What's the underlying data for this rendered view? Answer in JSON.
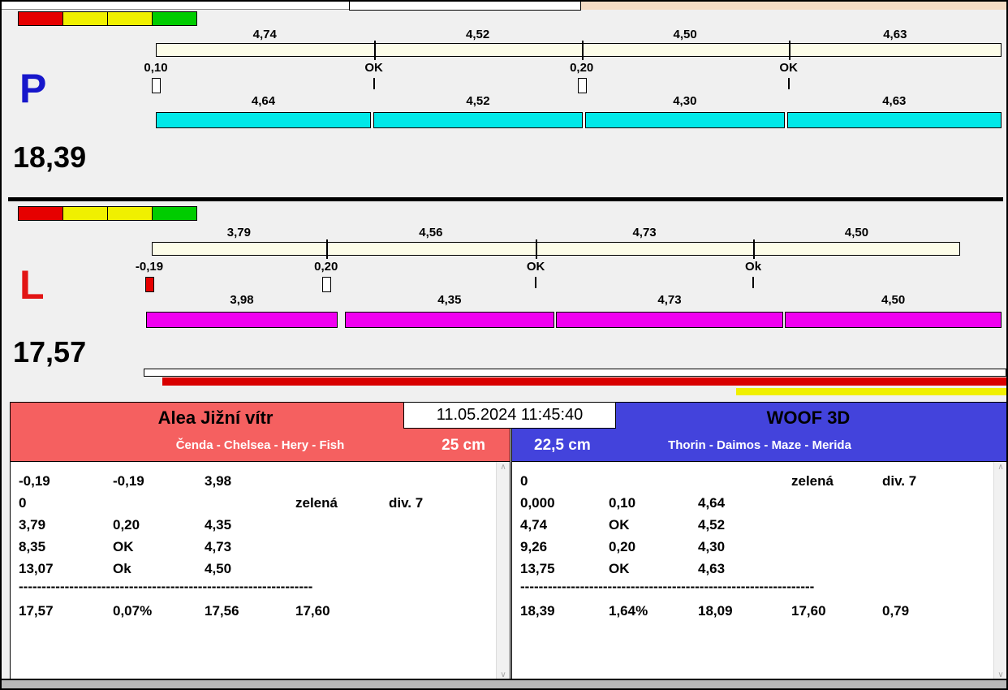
{
  "ui": {
    "datetime": "11.05.2024 11:45:40",
    "scrollbar_up": "∧",
    "scrollbar_down": "∨",
    "colors": {
      "background": "#f0f0f0",
      "top_strip_right": "#f5dcc4",
      "progress_red": "#d80000",
      "progress_yellow": "#f0f000"
    }
  },
  "lanes": [
    {
      "letter": "P",
      "letter_color": "#1717cb",
      "total": "18,39",
      "indicator_colors": [
        "#e60000",
        "#f0f000",
        "#f0f000",
        "#00cc00"
      ],
      "reference_bar": {
        "color": "#fcfce8",
        "segments": [
          {
            "label": "4,74",
            "value": 4.74
          },
          {
            "label": "4,52",
            "value": 4.52
          },
          {
            "label": "4,50",
            "value": 4.5
          },
          {
            "label": "4,63",
            "value": 4.63
          }
        ]
      },
      "penalties": [
        {
          "label": "0,10",
          "marker": "box",
          "marker_color": "#ffffff"
        },
        {
          "label": "OK",
          "marker": "tick"
        },
        {
          "label": "0,20",
          "marker": "box",
          "marker_color": "#ffffff"
        },
        {
          "label": "OK",
          "marker": "tick"
        }
      ],
      "run_bar": {
        "color": "#00e8e8",
        "segments": [
          {
            "label": "4,64",
            "value": 4.64
          },
          {
            "label": "4,52",
            "value": 4.52
          },
          {
            "label": "4,30",
            "value": 4.3
          },
          {
            "label": "4,63",
            "value": 4.63
          }
        ]
      }
    },
    {
      "letter": "L",
      "letter_color": "#e21414",
      "total": "17,57",
      "indicator_colors": [
        "#e60000",
        "#f0f000",
        "#f0f000",
        "#00cc00"
      ],
      "reference_bar": {
        "color": "#fcfce8",
        "segments": [
          {
            "label": "3,79",
            "value": 3.79
          },
          {
            "label": "4,56",
            "value": 4.56
          },
          {
            "label": "4,73",
            "value": 4.73
          },
          {
            "label": "4,50",
            "value": 4.5
          }
        ]
      },
      "penalties": [
        {
          "label": "-0,19",
          "marker": "box",
          "marker_color": "#e60000"
        },
        {
          "label": "0,20",
          "marker": "box",
          "marker_color": "#ffffff"
        },
        {
          "label": "OK",
          "marker": "tick"
        },
        {
          "label": "Ok",
          "marker": "tick"
        }
      ],
      "run_bar": {
        "color": "#f000f0",
        "segments": [
          {
            "label": "3,98",
            "value": 3.98
          },
          {
            "label": "4,35",
            "value": 4.35
          },
          {
            "label": "4,73",
            "value": 4.73
          },
          {
            "label": "4,50",
            "value": 4.5
          }
        ]
      }
    }
  ],
  "teams": [
    {
      "title": "Alea Jižní vítr",
      "members": "Čenda - Chelsea - Hery - Fish",
      "height": "25 cm",
      "header_color": "#f56060",
      "rows": [
        [
          "-0,19",
          "-0,19",
          "3,98",
          "",
          ""
        ],
        [
          "0",
          "",
          "",
          "zelená",
          "div. 7"
        ],
        [
          "3,79",
          "0,20",
          "4,35",
          "",
          ""
        ],
        [
          "8,35",
          "OK",
          "4,73",
          "",
          ""
        ],
        [
          "13,07",
          "Ok",
          "4,50",
          "",
          ""
        ]
      ],
      "separator": "----------------------------------------------------------------",
      "totals": [
        "17,57",
        "0,07%",
        "17,56",
        "17,60",
        ""
      ]
    },
    {
      "title": "WOOF 3D",
      "members": "Thorin - Daimos - Maze - Merida",
      "height": "22,5 cm",
      "header_color": "#4343dc",
      "rows": [
        [
          "0",
          "",
          "",
          "zelená",
          "div. 7"
        ],
        [
          "0,000",
          "0,10",
          "4,64",
          "",
          ""
        ],
        [
          "4,74",
          "OK",
          "4,52",
          "",
          ""
        ],
        [
          "9,26",
          "0,20",
          "4,30",
          "",
          ""
        ],
        [
          "13,75",
          "OK",
          "4,63",
          "",
          ""
        ]
      ],
      "separator": "----------------------------------------------------------------",
      "totals": [
        "18,39",
        "1,64%",
        "18,09",
        "17,60",
        "0,79"
      ]
    }
  ]
}
